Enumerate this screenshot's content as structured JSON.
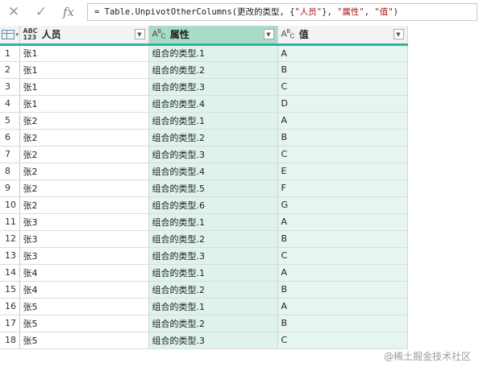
{
  "formula_bar": {
    "cancel_icon": "close-icon",
    "confirm_icon": "checkmark-icon",
    "fx_label": "fx",
    "formula_prefix": "= Table.UnpivotOtherColumns(更改的类型, {",
    "formula_str1": "\"人员\"",
    "formula_mid": "}, ",
    "formula_str2": "\"属性\"",
    "formula_sep": ", ",
    "formula_str3": "\"值\"",
    "formula_suffix": ")"
  },
  "columns": [
    {
      "name": "人员",
      "type_icon": "ABC 123",
      "type_name": "any-type-icon"
    },
    {
      "name": "属性",
      "type_icon": "ABC",
      "type_name": "text-type-icon"
    },
    {
      "name": "值",
      "type_icon": "ABC",
      "type_name": "text-type-icon"
    }
  ],
  "rows": [
    [
      "1",
      "张1",
      "组合的类型.1",
      "A"
    ],
    [
      "2",
      "张1",
      "组合的类型.2",
      "B"
    ],
    [
      "3",
      "张1",
      "组合的类型.3",
      "C"
    ],
    [
      "4",
      "张1",
      "组合的类型.4",
      "D"
    ],
    [
      "5",
      "张2",
      "组合的类型.1",
      "A"
    ],
    [
      "6",
      "张2",
      "组合的类型.2",
      "B"
    ],
    [
      "7",
      "张2",
      "组合的类型.3",
      "C"
    ],
    [
      "8",
      "张2",
      "组合的类型.4",
      "E"
    ],
    [
      "9",
      "张2",
      "组合的类型.5",
      "F"
    ],
    [
      "10",
      "张2",
      "组合的类型.6",
      "G"
    ],
    [
      "11",
      "张3",
      "组合的类型.1",
      "A"
    ],
    [
      "12",
      "张3",
      "组合的类型.2",
      "B"
    ],
    [
      "13",
      "张3",
      "组合的类型.3",
      "C"
    ],
    [
      "14",
      "张4",
      "组合的类型.1",
      "A"
    ],
    [
      "15",
      "张4",
      "组合的类型.2",
      "B"
    ],
    [
      "16",
      "张5",
      "组合的类型.1",
      "A"
    ],
    [
      "17",
      "张5",
      "组合的类型.2",
      "B"
    ],
    [
      "18",
      "张5",
      "组合的类型.3",
      "C"
    ]
  ],
  "watermark": "@稀土掘金技术社区",
  "colors": {
    "header_accent": "#2fb4a0",
    "selected_header": "#a8dcc8",
    "selected_column": "#dff3ea"
  }
}
